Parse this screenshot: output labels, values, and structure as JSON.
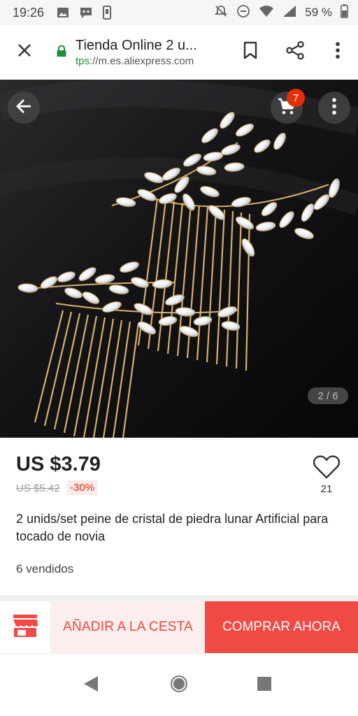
{
  "status": {
    "time": "19:26",
    "battery_text": "59 %"
  },
  "browser": {
    "title": "Tienda Online 2 u...",
    "url_scheme": "tps:",
    "url_host": "//m.es.aliexpress.com"
  },
  "gallery": {
    "cart_count": "7",
    "pager": "2 / 6"
  },
  "product": {
    "price": "US $3.79",
    "original_price": "US $5.42",
    "discount": "-30%",
    "wishlist_count": "21",
    "title": "2 unids/set peine de cristal de piedra lunar Artificial para tocado de novia",
    "sold": "6 vendidos"
  },
  "actions": {
    "add_to_cart": "AÑADIR A LA CESTA",
    "buy_now": "COMPRAR AHORA"
  },
  "colors": {
    "accent": "#f14a45",
    "accent_light": "#fdeeee",
    "badge": "#e62e04",
    "lock_green": "#1e8e3e"
  },
  "icons": [
    "picture-icon",
    "assistant-icon",
    "phone-icon",
    "mute-icon",
    "dnd-icon",
    "wifi-icon",
    "signal-icon",
    "battery-icon",
    "close-icon",
    "lock-icon",
    "bookmark-icon",
    "share-icon",
    "more-vert-icon",
    "back-arrow-icon",
    "cart-icon",
    "heart-icon",
    "store-icon",
    "nav-back-icon",
    "nav-home-icon",
    "nav-recents-icon"
  ]
}
